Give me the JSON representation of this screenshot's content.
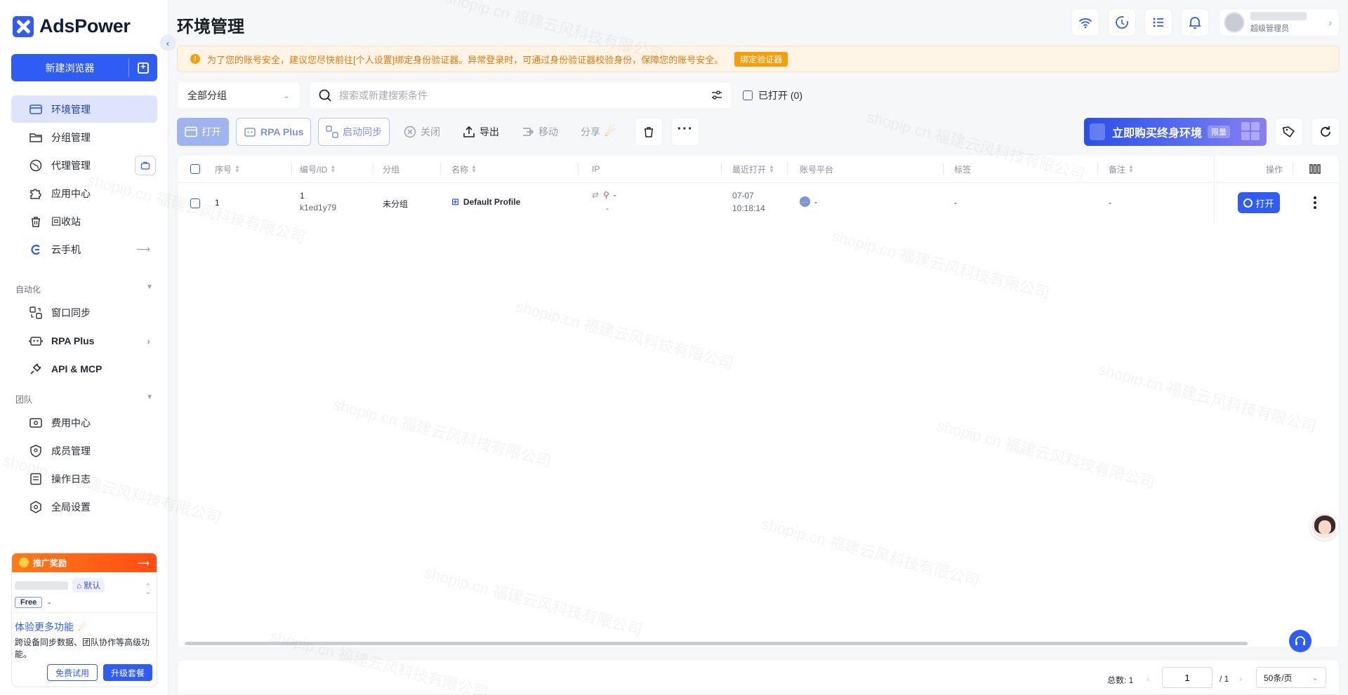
{
  "app": {
    "logo_text": "AdsPower",
    "brand_color": "#2f5cf5",
    "collapse_icon": "chevron-left-icon"
  },
  "sidebar": {
    "new_browser_label": "新建浏览器",
    "nav": [
      {
        "label": "环境管理",
        "icon": "browser-window-icon",
        "active": true
      },
      {
        "label": "分组管理",
        "icon": "folder-icon"
      },
      {
        "label": "代理管理",
        "icon": "globe-icon"
      },
      {
        "label": "应用中心",
        "icon": "puzzle-icon"
      },
      {
        "label": "回收站",
        "icon": "trash-icon"
      },
      {
        "label": "云手机",
        "icon": "cloud-phone-icon"
      }
    ],
    "automation_title": "自动化",
    "automation": [
      {
        "label": "窗口同步",
        "icon": "window-sync-icon"
      },
      {
        "label": "RPA Plus",
        "icon": "robot-icon"
      },
      {
        "label": "API & MCP",
        "icon": "plug-icon"
      }
    ],
    "team_title": "团队",
    "team": [
      {
        "label": "费用中心",
        "icon": "wallet-icon"
      },
      {
        "label": "成员管理",
        "icon": "shield-user-icon"
      },
      {
        "label": "操作日志",
        "icon": "log-icon"
      },
      {
        "label": "全局设置",
        "icon": "settings-hex-icon"
      }
    ],
    "promo": {
      "header": "推广奖励",
      "default_label": "默认",
      "plan": "Free",
      "plan_value": "-",
      "title": "体验更多功能",
      "desc": "跨设备同步数据、团队协作等高级功能。",
      "free_trial": "免费试用",
      "upgrade": "升级套餐"
    }
  },
  "header": {
    "title": "环境管理",
    "user_role": "超级管理员",
    "icons": [
      "wifi-icon",
      "sync-icon",
      "task-list-icon",
      "bell-icon"
    ]
  },
  "notice": {
    "text": "为了您的账号安全，建议您尽快前往[个人设置]绑定身份验证器。异常登录时，可通过身份验证器校验身份，保障您的账号安全。",
    "button": "绑定验证器"
  },
  "filters": {
    "group_select": "全部分组",
    "search_placeholder": "搜索或新建搜索条件",
    "opened_label": "已打开 (0)"
  },
  "toolbar": {
    "open": "打开",
    "rpa_plus": "RPA Plus",
    "start_sync": "启动同步",
    "close": "关闭",
    "export": "导出",
    "move": "移动",
    "share": "分享",
    "buy_banner": "立即购买终身环境",
    "buy_tag": "限量"
  },
  "table": {
    "columns": [
      "序号",
      "编号/ID",
      "分组",
      "名称",
      "IP",
      "最近打开",
      "账号平台",
      "标签",
      "备注",
      "操作"
    ],
    "rows": [
      {
        "index": "1",
        "number": "1",
        "id": "k1ed1y79",
        "group": "未分组",
        "name": "Default Profile",
        "ip": "-",
        "ip_sub": "-",
        "last_open_date": "07-07",
        "last_open_time": "10:18:14",
        "platform": "-",
        "tags": "-",
        "remark": "-",
        "action": "打开"
      }
    ]
  },
  "pagination": {
    "total": "总数: 1",
    "current_page": "1",
    "total_pages": "/ 1",
    "page_size": "50条/页"
  },
  "watermark": "shopip.cn 福建云风科技有限公司"
}
